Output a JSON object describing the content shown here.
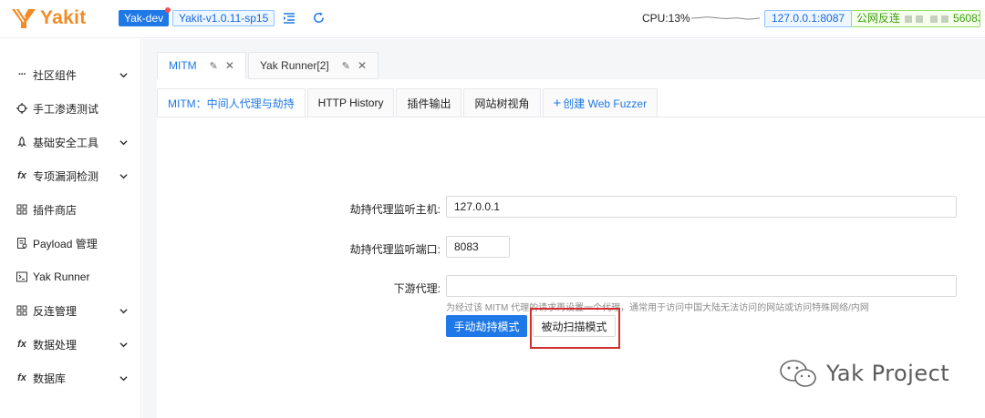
{
  "app": {
    "logo_text": "Yakit",
    "env_tag": "Yak-dev",
    "version_tag": "Yakit-v1.0.11-sp15",
    "cpu_label": "CPU:13%",
    "host_tag": "127.0.0.1:8087",
    "reverse_prefix": "公网反连",
    "reverse_suffix": "56083",
    "accent_color": "#1e78e6",
    "logo_color": "#f28b26"
  },
  "sidebar": {
    "items": [
      {
        "icon": "ellipsis-icon",
        "label": "社区组件",
        "has_children": true
      },
      {
        "icon": "target-icon",
        "label": "手工渗透测试",
        "has_children": false
      },
      {
        "icon": "rocket-icon",
        "label": "基础安全工具",
        "has_children": true
      },
      {
        "icon": "fx-icon",
        "label": "专项漏洞检测",
        "has_children": true
      },
      {
        "icon": "grid-icon",
        "label": "插件商店",
        "has_children": false
      },
      {
        "icon": "payload-icon",
        "label": "Payload 管理",
        "has_children": false
      },
      {
        "icon": "terminal-icon",
        "label": "Yak Runner",
        "has_children": false
      },
      {
        "icon": "grid-icon",
        "label": "反连管理",
        "has_children": true
      },
      {
        "icon": "fx-icon",
        "label": "数据处理",
        "has_children": true
      },
      {
        "icon": "fx-icon",
        "label": "数据库",
        "has_children": true
      }
    ]
  },
  "tabs": [
    {
      "label": "MITM",
      "active": true
    },
    {
      "label": "Yak Runner[2]",
      "active": false
    }
  ],
  "subtabs": [
    {
      "label": "MITM：中间人代理与劫持",
      "active": true
    },
    {
      "label": "HTTP History",
      "active": false
    },
    {
      "label": "插件输出",
      "active": false
    },
    {
      "label": "网站树视角",
      "active": false
    },
    {
      "label": "创建 Web Fuzzer",
      "active": false
    }
  ],
  "form": {
    "host_label": "劫持代理监听主机:",
    "host_value": "127.0.0.1",
    "port_label": "劫持代理监听端口:",
    "port_value": "8083",
    "downstream_label": "下游代理:",
    "downstream_value": "",
    "downstream_hint": "为经过该 MITM 代理的请求再设置一个代理，通常用于访问中国大陆无法访问的网站或访问特殊网络/内网",
    "manual_button": "手动劫持模式",
    "passive_button": "被动扫描模式"
  },
  "watermark": {
    "text": "Yak Project"
  }
}
